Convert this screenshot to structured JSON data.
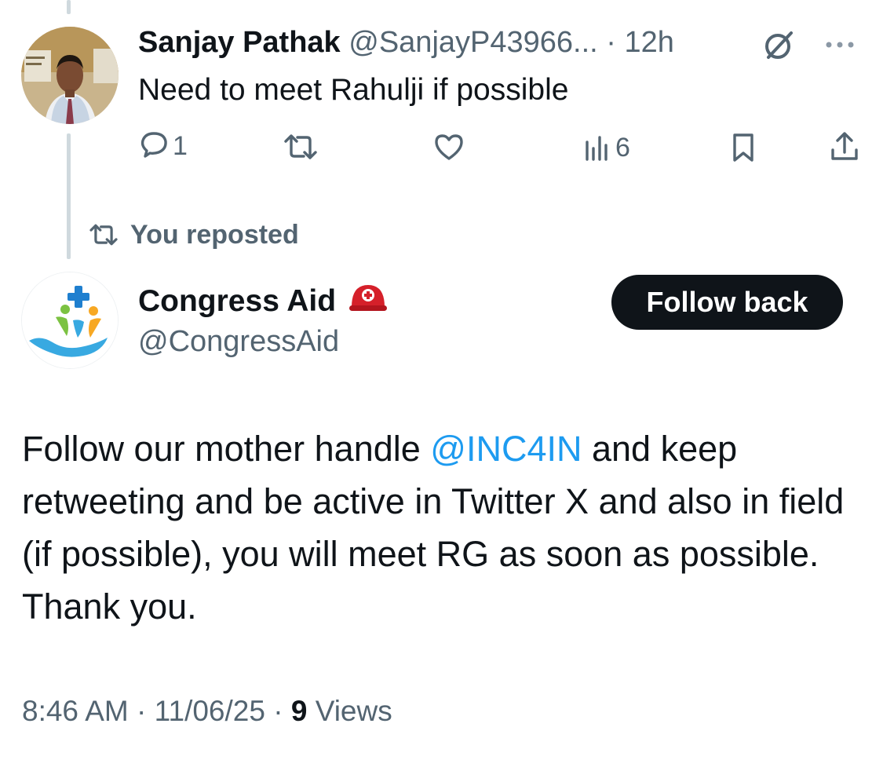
{
  "reply": {
    "author_name": "Sanjay Pathak",
    "handle": "@SanjayP43966...",
    "separator": " · ",
    "time": "12h",
    "text": "Need to meet Rahulji if possible",
    "replies_count": "1",
    "views_count": "6",
    "icons": {
      "grok": "grok-slash-icon",
      "more": "more-dots-icon",
      "reply": "speech-bubble-icon",
      "repost": "repost-arrows-icon",
      "like": "heart-icon",
      "views": "bar-chart-icon",
      "bookmark": "bookmark-icon",
      "share": "share-upload-icon"
    }
  },
  "repost_note": {
    "label": "You reposted",
    "icon": "repost-arrows-icon"
  },
  "post": {
    "author_name": "Congress Aid",
    "badge_icon": "red-rescue-helmet-icon",
    "handle": "@CongressAid",
    "follow_label": "Follow back",
    "text_before": "Follow our mother handle ",
    "mention": "@INC4IN",
    "text_after": " and keep retweeting and be active in Twitter X and also in field (if possible), you will meet RG as soon as possible. Thank you.",
    "time": "8:46 AM",
    "separator": " · ",
    "date": "11/06/25",
    "views_count": "9",
    "views_label": "Views"
  },
  "colors": {
    "text": "#0f1419",
    "muted": "#536471",
    "link": "#1d9bf0",
    "thread_line": "#cfd9de",
    "button_bg": "#0f1419",
    "badge_red": "#d5202a"
  }
}
